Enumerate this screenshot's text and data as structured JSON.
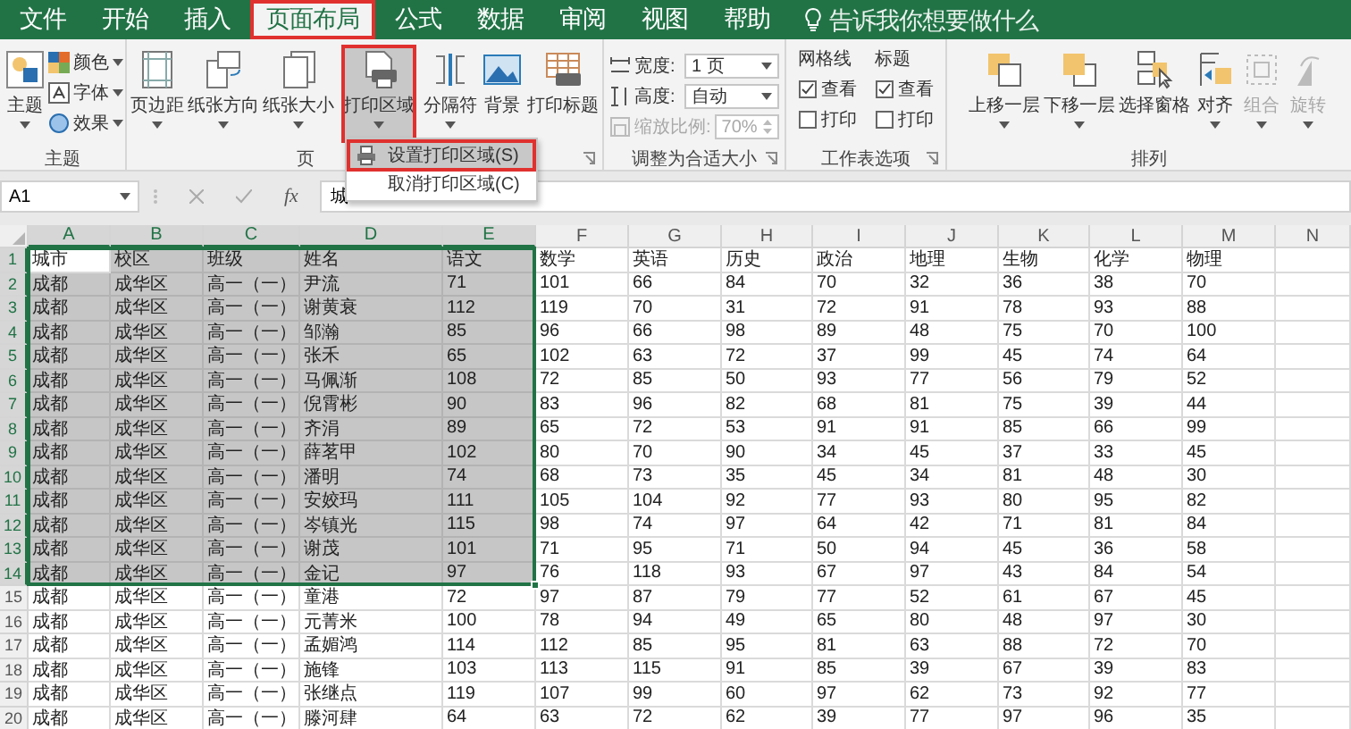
{
  "tabs": [
    {
      "label": "文件",
      "selected": false,
      "annotated": false
    },
    {
      "label": "开始",
      "selected": false,
      "annotated": false
    },
    {
      "label": "插入",
      "selected": false,
      "annotated": false
    },
    {
      "label": "页面布局",
      "selected": true,
      "annotated": true
    },
    {
      "label": "公式",
      "selected": false,
      "annotated": false
    },
    {
      "label": "数据",
      "selected": false,
      "annotated": false
    },
    {
      "label": "审阅",
      "selected": false,
      "annotated": false
    },
    {
      "label": "视图",
      "selected": false,
      "annotated": false
    },
    {
      "label": "帮助",
      "selected": false,
      "annotated": false
    }
  ],
  "tell_me": {
    "placeholder": "告诉我你想要做什么"
  },
  "ribbon": {
    "themes": {
      "label": "主题",
      "button": "主题",
      "items": [
        "颜色",
        "字体",
        "效果"
      ]
    },
    "page_setup": {
      "label": "页",
      "buttons": [
        {
          "label": "页边距",
          "dropdown": true,
          "pressed": false,
          "annotated": false
        },
        {
          "label": "纸张方向",
          "dropdown": true,
          "pressed": false,
          "annotated": false
        },
        {
          "label": "纸张大小",
          "dropdown": true,
          "pressed": false,
          "annotated": false
        },
        {
          "label": "打印区域",
          "dropdown": true,
          "pressed": true,
          "annotated": true
        },
        {
          "label": "分隔符",
          "dropdown": true,
          "pressed": false,
          "annotated": false
        },
        {
          "label": "背景",
          "dropdown": false,
          "pressed": false,
          "annotated": false
        },
        {
          "label": "打印标题",
          "dropdown": false,
          "pressed": false,
          "annotated": false
        }
      ]
    },
    "scale_to_fit": {
      "label": "调整为合适大小",
      "fields": [
        {
          "kind": "dropdown",
          "label": "宽度:",
          "value": "1 页",
          "disabled": false
        },
        {
          "kind": "dropdown",
          "label": "高度:",
          "value": "自动",
          "disabled": false
        },
        {
          "kind": "spinner",
          "label": "缩放比例:",
          "value": "70%",
          "disabled": true
        }
      ]
    },
    "sheet_options": {
      "label": "工作表选项",
      "columns": [
        {
          "title": "网格线",
          "options": [
            {
              "label": "查看",
              "checked": true
            },
            {
              "label": "打印",
              "checked": false
            }
          ]
        },
        {
          "title": "标题",
          "options": [
            {
              "label": "查看",
              "checked": true
            },
            {
              "label": "打印",
              "checked": false
            }
          ]
        }
      ]
    },
    "arrange": {
      "label": "排列",
      "buttons": [
        {
          "label": "上移一层",
          "dropdown": true,
          "disabled": false
        },
        {
          "label": "下移一层",
          "dropdown": true,
          "disabled": false
        },
        {
          "label": "选择窗格",
          "dropdown": false,
          "disabled": false
        },
        {
          "label": "对齐",
          "dropdown": true,
          "disabled": false
        },
        {
          "label": "组合",
          "dropdown": true,
          "disabled": true
        },
        {
          "label": "旋转",
          "dropdown": true,
          "disabled": true
        }
      ]
    }
  },
  "formula_bar": {
    "name_box": "A1",
    "function_symbol": "fx",
    "value": "城"
  },
  "sheet": {
    "columns": [
      {
        "label": "A",
        "selected": true
      },
      {
        "label": "B",
        "selected": true
      },
      {
        "label": "C",
        "selected": true
      },
      {
        "label": "D",
        "selected": true
      },
      {
        "label": "E",
        "selected": true
      },
      {
        "label": "F",
        "selected": false
      },
      {
        "label": "G",
        "selected": false
      },
      {
        "label": "H",
        "selected": false
      },
      {
        "label": "I",
        "selected": false
      },
      {
        "label": "J",
        "selected": false
      },
      {
        "label": "K",
        "selected": false
      },
      {
        "label": "L",
        "selected": false
      },
      {
        "label": "M",
        "selected": false
      },
      {
        "label": "N",
        "selected": false
      }
    ],
    "rows": [
      {
        "number": "1",
        "selected": true,
        "cells": [
          "城市",
          "校区",
          "班级",
          "姓名",
          "语文",
          "数学",
          "英语",
          "历史",
          "政治",
          "地理",
          "生物",
          "化学",
          "物理"
        ]
      },
      {
        "number": "2",
        "selected": true,
        "cells": [
          "成都",
          "成华区",
          "高一（一）",
          "尹流",
          "71",
          "101",
          "66",
          "84",
          "70",
          "32",
          "36",
          "38",
          "70"
        ]
      },
      {
        "number": "3",
        "selected": true,
        "cells": [
          "成都",
          "成华区",
          "高一（一）",
          "谢黄衰",
          "112",
          "119",
          "70",
          "31",
          "72",
          "91",
          "78",
          "93",
          "88"
        ]
      },
      {
        "number": "4",
        "selected": true,
        "cells": [
          "成都",
          "成华区",
          "高一（一）",
          "邹瀚",
          "85",
          "96",
          "66",
          "98",
          "89",
          "48",
          "75",
          "70",
          "100"
        ]
      },
      {
        "number": "5",
        "selected": true,
        "cells": [
          "成都",
          "成华区",
          "高一（一）",
          "张禾",
          "65",
          "102",
          "63",
          "72",
          "37",
          "99",
          "45",
          "74",
          "64"
        ]
      },
      {
        "number": "6",
        "selected": true,
        "cells": [
          "成都",
          "成华区",
          "高一（一）",
          "马佩渐",
          "108",
          "72",
          "85",
          "50",
          "93",
          "77",
          "56",
          "79",
          "52"
        ]
      },
      {
        "number": "7",
        "selected": true,
        "cells": [
          "成都",
          "成华区",
          "高一（一）",
          "倪霄彬",
          "90",
          "83",
          "96",
          "82",
          "68",
          "81",
          "75",
          "39",
          "44"
        ]
      },
      {
        "number": "8",
        "selected": true,
        "cells": [
          "成都",
          "成华区",
          "高一（一）",
          "齐涓",
          "89",
          "65",
          "72",
          "53",
          "91",
          "91",
          "85",
          "66",
          "99"
        ]
      },
      {
        "number": "9",
        "selected": true,
        "cells": [
          "成都",
          "成华区",
          "高一（一）",
          "薛茗甲",
          "102",
          "80",
          "70",
          "90",
          "34",
          "45",
          "37",
          "33",
          "45"
        ]
      },
      {
        "number": "10",
        "selected": true,
        "cells": [
          "成都",
          "成华区",
          "高一（一）",
          "潘明",
          "74",
          "68",
          "73",
          "35",
          "45",
          "34",
          "81",
          "48",
          "30"
        ]
      },
      {
        "number": "11",
        "selected": true,
        "cells": [
          "成都",
          "成华区",
          "高一（一）",
          "安姣玛",
          "111",
          "105",
          "104",
          "92",
          "77",
          "93",
          "80",
          "95",
          "82"
        ]
      },
      {
        "number": "12",
        "selected": true,
        "cells": [
          "成都",
          "成华区",
          "高一（一）",
          "岑镇光",
          "115",
          "98",
          "74",
          "97",
          "64",
          "42",
          "71",
          "81",
          "84"
        ]
      },
      {
        "number": "13",
        "selected": true,
        "cells": [
          "成都",
          "成华区",
          "高一（一）",
          "谢茂",
          "101",
          "71",
          "95",
          "71",
          "50",
          "94",
          "45",
          "36",
          "58"
        ]
      },
      {
        "number": "14",
        "selected": true,
        "cells": [
          "成都",
          "成华区",
          "高一（一）",
          "金记",
          "97",
          "76",
          "118",
          "93",
          "67",
          "97",
          "43",
          "84",
          "54"
        ]
      },
      {
        "number": "15",
        "selected": false,
        "cells": [
          "成都",
          "成华区",
          "高一（一）",
          "童港",
          "72",
          "97",
          "87",
          "79",
          "77",
          "52",
          "61",
          "67",
          "45"
        ]
      },
      {
        "number": "16",
        "selected": false,
        "cells": [
          "成都",
          "成华区",
          "高一（一）",
          "元菁米",
          "100",
          "78",
          "94",
          "49",
          "65",
          "80",
          "48",
          "97",
          "30"
        ]
      },
      {
        "number": "17",
        "selected": false,
        "cells": [
          "成都",
          "成华区",
          "高一（一）",
          "孟媚鸿",
          "114",
          "112",
          "85",
          "95",
          "81",
          "63",
          "88",
          "72",
          "70"
        ]
      },
      {
        "number": "18",
        "selected": false,
        "cells": [
          "成都",
          "成华区",
          "高一（一）",
          "施锋",
          "103",
          "113",
          "115",
          "91",
          "85",
          "39",
          "67",
          "39",
          "83"
        ]
      },
      {
        "number": "19",
        "selected": false,
        "cells": [
          "成都",
          "成华区",
          "高一（一）",
          "张继点",
          "119",
          "107",
          "99",
          "60",
          "97",
          "62",
          "73",
          "92",
          "77"
        ]
      },
      {
        "number": "20",
        "selected": false,
        "cells": [
          "成都",
          "成华区",
          "高一（一）",
          "滕河肆",
          "64",
          "63",
          "72",
          "62",
          "39",
          "77",
          "97",
          "96",
          "35"
        ]
      }
    ]
  },
  "menu": {
    "items": [
      {
        "label": "设置打印区域(S)",
        "hovered": true,
        "annotated": true
      },
      {
        "label": "取消打印区域(C)",
        "hovered": false,
        "annotated": false
      }
    ]
  }
}
